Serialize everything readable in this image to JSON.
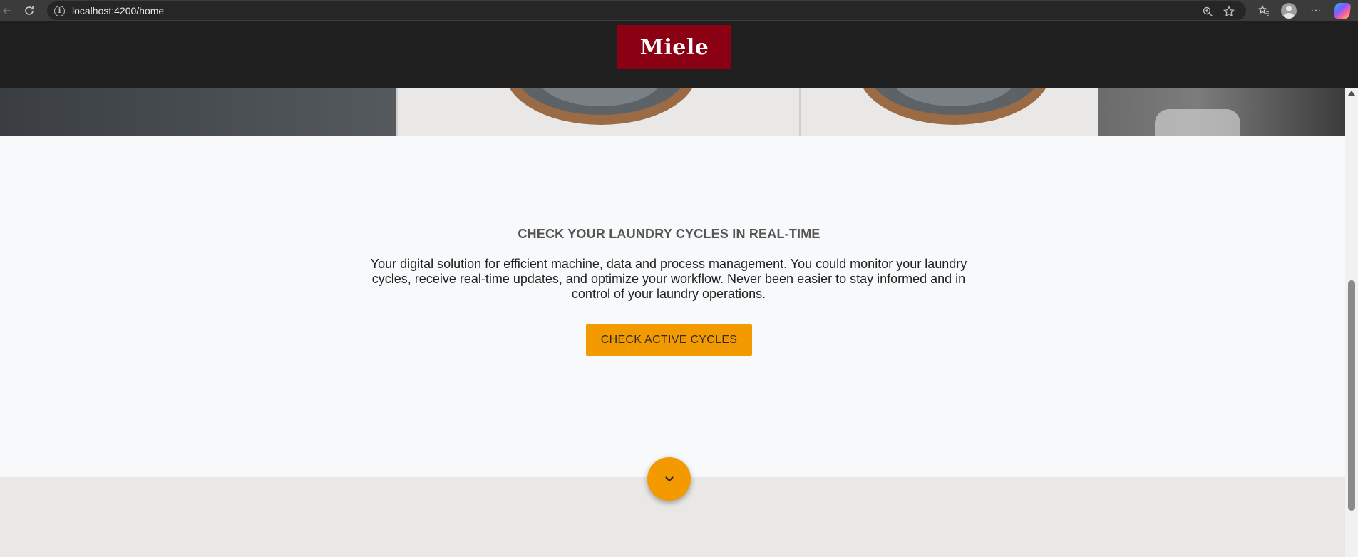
{
  "browser": {
    "url": "localhost:4200/home",
    "icons": {
      "back": "back-arrow-icon",
      "reload": "reload-icon",
      "site_info": "info-icon",
      "zoom": "zoom-icon",
      "favorite": "star-icon",
      "favorites_list": "favorites-icon",
      "profile": "profile-avatar",
      "menu": "more-icon",
      "copilot": "copilot-icon"
    },
    "menu_glyph": "···"
  },
  "header": {
    "logo_text": "Miele",
    "background": "#1f1f1f",
    "logo_color": "#8c0014"
  },
  "main": {
    "headline": "CHECK YOUR LAUNDRY CYCLES IN REAL-TIME",
    "description": "Your digital solution for efficient machine, data and process management. You could monitor your laundry cycles, receive real-time updates, and optimize your workflow. Never been easier to stay informed and in control of your laundry operations.",
    "cta_label": "CHECK ACTIVE CYCLES",
    "accent": "#f29a00",
    "scroll_icon": "chevron-down-icon"
  }
}
